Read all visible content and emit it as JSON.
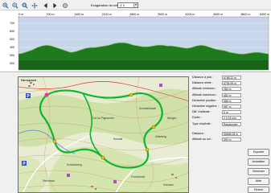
{
  "toolbar": {
    "icons": [
      "zoom-in-icon",
      "zoom-out-icon",
      "zoom-fit-icon",
      "pan-icon",
      "arrow-left-icon",
      "arrow-right-icon",
      "settings-icon"
    ],
    "exaggeration_label": "Exagération du relief :",
    "exaggeration_value": "X 2"
  },
  "profile": {
    "x_ticks": [
      "0 m",
      "700 m",
      "1400 m",
      "2100 m",
      "2800 m",
      "3500 m",
      "4200 m",
      "4900 m",
      "5600 m",
      "6300 m"
    ],
    "y_ticks": [
      "700",
      "600",
      "500",
      "400",
      "300",
      "200"
    ],
    "colors": {
      "fill": "#1f7a1f",
      "sky": "#c8d6ec",
      "line": "#9ecf7a"
    }
  },
  "stats": [
    {
      "label": "Distance à plat :",
      "value": "6768.22 m"
    },
    {
      "label": "Distance réelle :",
      "value": "6795.99 m"
    },
    {
      "label": "Altitude minimum :",
      "value": "284 m"
    },
    {
      "label": "Altitude maximum :",
      "value": "482 m"
    },
    {
      "label": "Dénivelée positive :",
      "value": "588 m"
    },
    {
      "label": "Dénivelée négative :",
      "value": "587 m"
    },
    {
      "label": "Diff. d'altitude :",
      "value": "0 m"
    },
    {
      "label": "Durée :",
      "value": "2 h 19 min"
    },
    {
      "label": "Type d'activité :",
      "value": "Randonnée"
    }
  ],
  "stats2": [
    {
      "label": "Distance :",
      "value": "95698.28 m"
    },
    {
      "label": "Altitude au sol :",
      "value": "392 m"
    }
  ],
  "buttons": {
    "export": "Exporter",
    "refresh": "Actualiser",
    "view": "Visionner",
    "help": "Aide",
    "close": "Fermer"
  },
  "map": {
    "place_label": "Hunspach",
    "labels": [
      "Col du Pigeonnier",
      "Schmeltzbach",
      "Kimmel",
      "Schlossberg",
      "Geisberg",
      "Steinbach",
      "Hohwart",
      "Froschmatt",
      "Wingen"
    ]
  }
}
